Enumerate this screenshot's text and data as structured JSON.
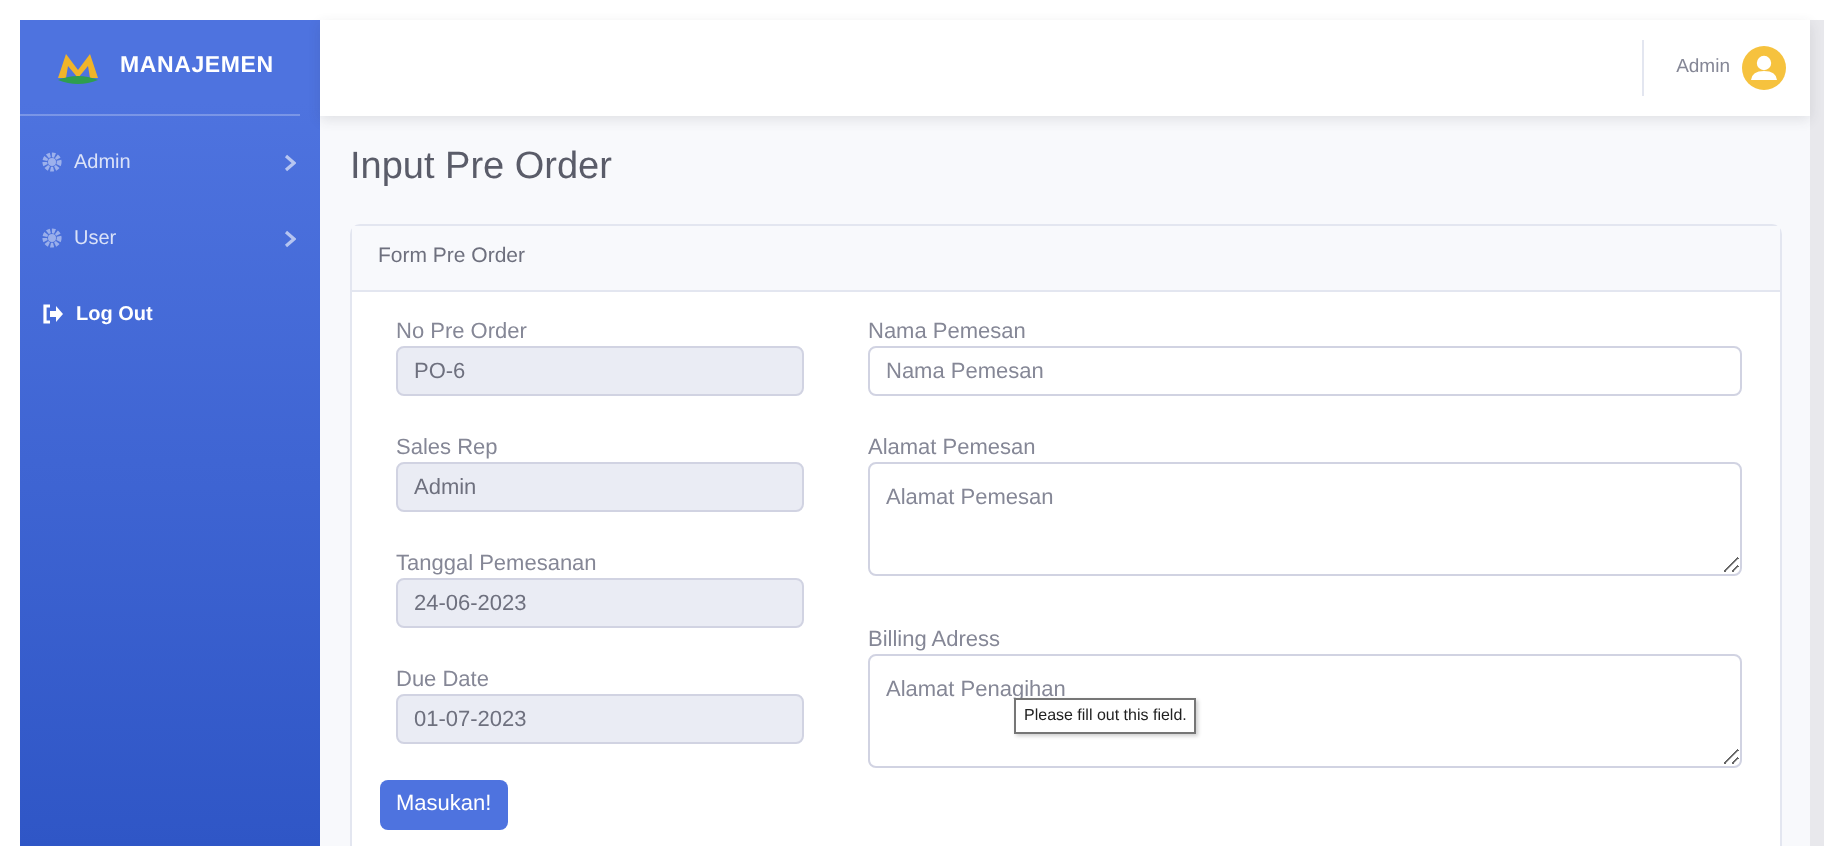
{
  "sidebar": {
    "brand": "MANAJEMEN",
    "items": [
      {
        "kind": "dropdown",
        "label": "Admin"
      },
      {
        "kind": "dropdown",
        "label": "User"
      },
      {
        "kind": "link",
        "label": "Log Out"
      }
    ]
  },
  "topbar": {
    "user": "Admin"
  },
  "page_title": "Input Pre Order",
  "card": {
    "title": "Form Pre Order",
    "left_fields": [
      {
        "kind": "input",
        "label": "No Pre Order",
        "value": "PO-6",
        "readonly": true
      },
      {
        "kind": "input",
        "label": "Sales Rep",
        "value": "Admin",
        "readonly": true
      },
      {
        "kind": "input",
        "label": "Tanggal Pemesanan",
        "value": "24-06-2023",
        "readonly": true
      },
      {
        "kind": "input",
        "label": "Due Date",
        "value": "01-07-2023",
        "readonly": true
      }
    ],
    "right_fields": [
      {
        "kind": "input",
        "label": "Nama Pemesan",
        "placeholder": "Nama Pemesan",
        "readonly": false
      },
      {
        "kind": "textarea",
        "label": "Alamat Pemesan",
        "placeholder": "Alamat Pemesan",
        "readonly": false
      },
      {
        "kind": "textarea",
        "label": "Billing Adress",
        "placeholder": "Alamat Penagihan",
        "readonly": false,
        "tooltip": "Please fill out this field."
      }
    ],
    "submit": "Masukan!"
  }
}
